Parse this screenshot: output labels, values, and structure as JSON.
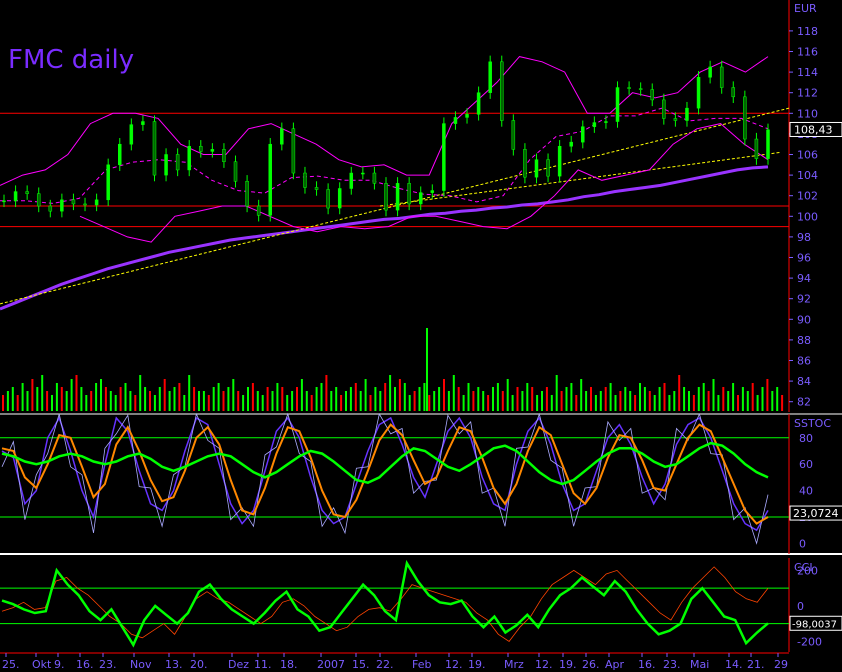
{
  "chart_data": [
    {
      "type": "candlestick",
      "title": "FMC daily",
      "currency_label": "EUR",
      "last_price": "108,43",
      "ylim": [
        81,
        121
      ],
      "y_ticks": [
        82,
        84,
        86,
        88,
        90,
        92,
        94,
        96,
        98,
        100,
        102,
        104,
        106,
        108,
        110,
        112,
        114,
        116,
        118
      ],
      "horizontal_lines": [
        110,
        101,
        99
      ],
      "x_tick_labels": [
        "25.",
        "Okt",
        "9.",
        "16.",
        "23.",
        "Nov",
        "13.",
        "20.",
        "Dez",
        "11.",
        "18.",
        "2007",
        "15.",
        "22.",
        "Feb",
        "12.",
        "19.",
        "Mrz",
        "12.",
        "19.",
        "26.",
        "Apr",
        "16.",
        "23.",
        "Mai",
        "14.",
        "21.",
        "29"
      ],
      "series": [
        {
          "name": "Close",
          "values": [
            101.5,
            102.4,
            102.2,
            101.0,
            100.5,
            101.6,
            101.2,
            101.1,
            101.6,
            105.0,
            107.0,
            108.9,
            109.2,
            104.0,
            106.0,
            104.5,
            106.8,
            106.3,
            106.5,
            105.3,
            103.4,
            101.0,
            100.1,
            107.0,
            108.5,
            104.2,
            102.8,
            102.6,
            100.8,
            102.7,
            104.2,
            104.2,
            103.2,
            100.6,
            103.2,
            101.2,
            102.3,
            102.5,
            109.0,
            109.6,
            109.9,
            112.0,
            115.0,
            109.3,
            106.5,
            103.8,
            105.5,
            103.9,
            106.8,
            107.2,
            108.7,
            109.1,
            109.2,
            112.5,
            112.4,
            112.3,
            111.3,
            109.5,
            109.3,
            110.5,
            113.5,
            114.5,
            112.5,
            111.6,
            107.5,
            105.6,
            108.4
          ]
        },
        {
          "name": "MA 200",
          "values": [
            91.0,
            91.6,
            92.2,
            92.8,
            93.4,
            93.9,
            94.4,
            94.9,
            95.3,
            95.7,
            96.1,
            96.5,
            96.8,
            97.1,
            97.4,
            97.7,
            97.9,
            98.1,
            98.3,
            98.5,
            98.7,
            98.9,
            99.1,
            99.3,
            99.5,
            99.7,
            99.8,
            100.0,
            100.2,
            100.3,
            100.5,
            100.6,
            100.8,
            100.9,
            101.1,
            101.2,
            101.4,
            101.6,
            101.9,
            102.1,
            102.4,
            102.6,
            102.8,
            103.0,
            103.3,
            103.6,
            103.9,
            104.2,
            104.5,
            104.7,
            104.8
          ]
        },
        {
          "name": "Bollinger Upper",
          "values": [
            103,
            104,
            104.5,
            106,
            109,
            110,
            110,
            109.5,
            107,
            106,
            106,
            108.5,
            109,
            108,
            107,
            105.5,
            104.8,
            105,
            104,
            104,
            109,
            111,
            113,
            115.5,
            115,
            114,
            110,
            110,
            112,
            111.5,
            112,
            114,
            115,
            114,
            115.5
          ]
        },
        {
          "name": "Bollinger Lower",
          "values": [
            100,
            99,
            98,
            97.5,
            100,
            100.5,
            101,
            101,
            100,
            99,
            98.5,
            99,
            98.8,
            99,
            100,
            100,
            99.5,
            99,
            98.8,
            100,
            102,
            104.5,
            103.5,
            104,
            104.5,
            107,
            108.5,
            109,
            107,
            105.5
          ]
        },
        {
          "name": "Volume",
          "values": [
            4,
            5,
            6,
            4,
            7,
            5,
            8,
            6,
            9,
            5,
            4,
            7,
            6,
            5,
            8,
            9,
            6,
            4,
            5,
            7,
            8,
            6,
            5,
            4,
            6,
            7,
            5,
            4,
            9,
            6,
            5,
            4,
            6,
            8,
            5,
            6,
            7,
            4,
            9,
            6,
            5,
            5,
            4,
            6,
            7,
            5,
            6,
            8,
            5,
            4,
            6,
            7,
            5,
            4,
            6,
            5,
            7,
            6,
            4,
            5,
            6,
            8,
            5,
            4,
            6,
            7,
            9,
            5,
            6,
            4,
            5,
            6,
            7,
            5,
            8,
            4,
            6,
            5,
            7,
            9,
            6,
            8,
            7,
            4,
            5,
            6,
            7,
            4,
            5,
            6,
            8,
            5,
            9,
            6,
            4,
            7,
            5,
            6,
            5,
            4,
            6,
            7,
            5,
            8,
            4,
            6,
            5,
            7,
            6,
            4,
            5,
            6,
            4,
            9,
            5,
            6,
            7,
            4,
            8,
            5,
            6,
            4,
            5,
            6,
            7,
            4,
            5,
            6,
            5,
            4,
            7,
            6,
            5,
            4,
            6,
            7,
            4,
            5,
            9,
            6,
            5,
            4,
            6,
            7,
            5,
            8,
            4,
            6,
            5,
            7,
            4,
            6,
            5,
            7,
            4,
            6,
            8,
            5,
            6,
            4
          ]
        }
      ]
    },
    {
      "type": "line",
      "title": "SSTOC",
      "last_value": "23,0724",
      "ylim": [
        -8,
        98
      ],
      "y_ticks": [
        0,
        20,
        40,
        60,
        80
      ],
      "horizontal_lines": [
        80,
        20
      ],
      "series": [
        {
          "name": "%K",
          "values": [
            70,
            65,
            30,
            40,
            80,
            95,
            70,
            40,
            20,
            60,
            95,
            85,
            55,
            30,
            25,
            40,
            70,
            95,
            90,
            60,
            30,
            15,
            25,
            55,
            85,
            95,
            80,
            50,
            25,
            15,
            20,
            45,
            70,
            90,
            95,
            75,
            50,
            35,
            60,
            85,
            95,
            80,
            50,
            30,
            25,
            60,
            85,
            95,
            75,
            45,
            25,
            30,
            55,
            80,
            90,
            75,
            50,
            30,
            45,
            75,
            90,
            95,
            80,
            55,
            30,
            15,
            10,
            25
          ]
        },
        {
          "name": "%D",
          "values": [
            72,
            70,
            50,
            42,
            60,
            82,
            80,
            58,
            35,
            45,
            75,
            88,
            70,
            48,
            32,
            35,
            55,
            80,
            88,
            75,
            48,
            25,
            22,
            42,
            68,
            88,
            85,
            65,
            40,
            22,
            20,
            33,
            55,
            78,
            90,
            82,
            63,
            45,
            50,
            70,
            88,
            85,
            65,
            42,
            30,
            45,
            70,
            88,
            82,
            60,
            38,
            30,
            42,
            65,
            82,
            80,
            63,
            42,
            40,
            60,
            80,
            90,
            85,
            65,
            45,
            25,
            15,
            20
          ]
        },
        {
          "name": "Signal",
          "values": [
            68,
            66,
            62,
            60,
            62,
            66,
            68,
            66,
            62,
            60,
            62,
            66,
            68,
            64,
            58,
            55,
            58,
            62,
            66,
            68,
            66,
            60,
            54,
            50,
            54,
            60,
            66,
            70,
            68,
            62,
            55,
            48,
            46,
            50,
            58,
            66,
            72,
            70,
            64,
            58,
            55,
            60,
            66,
            72,
            74,
            70,
            62,
            54,
            48,
            45,
            48,
            55,
            62,
            68,
            72,
            72,
            68,
            62,
            58,
            60,
            66,
            72,
            76,
            74,
            68,
            60,
            54,
            50
          ]
        }
      ]
    },
    {
      "type": "line",
      "title": "CCI",
      "last_value": "-98,0037",
      "ylim": [
        -260,
        270
      ],
      "y_ticks": [
        -200,
        0,
        200
      ],
      "horizontal_lines": [
        100,
        -100
      ],
      "series": [
        {
          "name": "CCI",
          "values": [
            30,
            10,
            -20,
            -40,
            -30,
            200,
            120,
            60,
            -30,
            -80,
            -20,
            -120,
            -220,
            -80,
            0,
            -50,
            -100,
            -40,
            80,
            120,
            40,
            -20,
            -60,
            -100,
            -40,
            30,
            80,
            -20,
            -60,
            -140,
            -120,
            -40,
            40,
            120,
            60,
            -30,
            -80,
            240,
            140,
            60,
            20,
            10,
            30,
            -60,
            -120,
            -60,
            -150,
            -110,
            -50,
            -120,
            -20,
            60,
            100,
            160,
            110,
            60,
            140,
            80,
            -20,
            -100,
            -160,
            -140,
            -100,
            40,
            100,
            20,
            -60,
            -80,
            -210,
            -150,
            -98
          ]
        },
        {
          "name": "Signal",
          "values": [
            -30,
            -10,
            20,
            -20,
            -10,
            140,
            160,
            100,
            60,
            0,
            -60,
            -100,
            -160,
            -180,
            -140,
            -100,
            -160,
            -60,
            40,
            80,
            40,
            20,
            -20,
            -60,
            -100,
            -60,
            20,
            40,
            0,
            -60,
            -100,
            -140,
            -120,
            -60,
            -20,
            -10,
            -30,
            40,
            120,
            100,
            80,
            60,
            40,
            20,
            -40,
            -80,
            -160,
            -200,
            -120,
            -60,
            40,
            120,
            160,
            200,
            160,
            120,
            180,
            200,
            140,
            80,
            20,
            -40,
            -80,
            20,
            100,
            160,
            220,
            160,
            80,
            40,
            20,
            100
          ]
        }
      ]
    }
  ],
  "colors": {
    "background": "#000000",
    "grid": "#ff0000",
    "up_candle": "#00ff00",
    "down_candle": "#ff0000",
    "ma200": "#9933ff",
    "bollinger": "#ff00ff",
    "trendline": "#ffff00",
    "oscillator_line": "#00ff00",
    "stoch_k": "#6633ff",
    "stoch_d": "#ff8800",
    "cci_signal": "#ff4400",
    "axis_text": "#7a5cff",
    "title": "#7a2cff"
  }
}
